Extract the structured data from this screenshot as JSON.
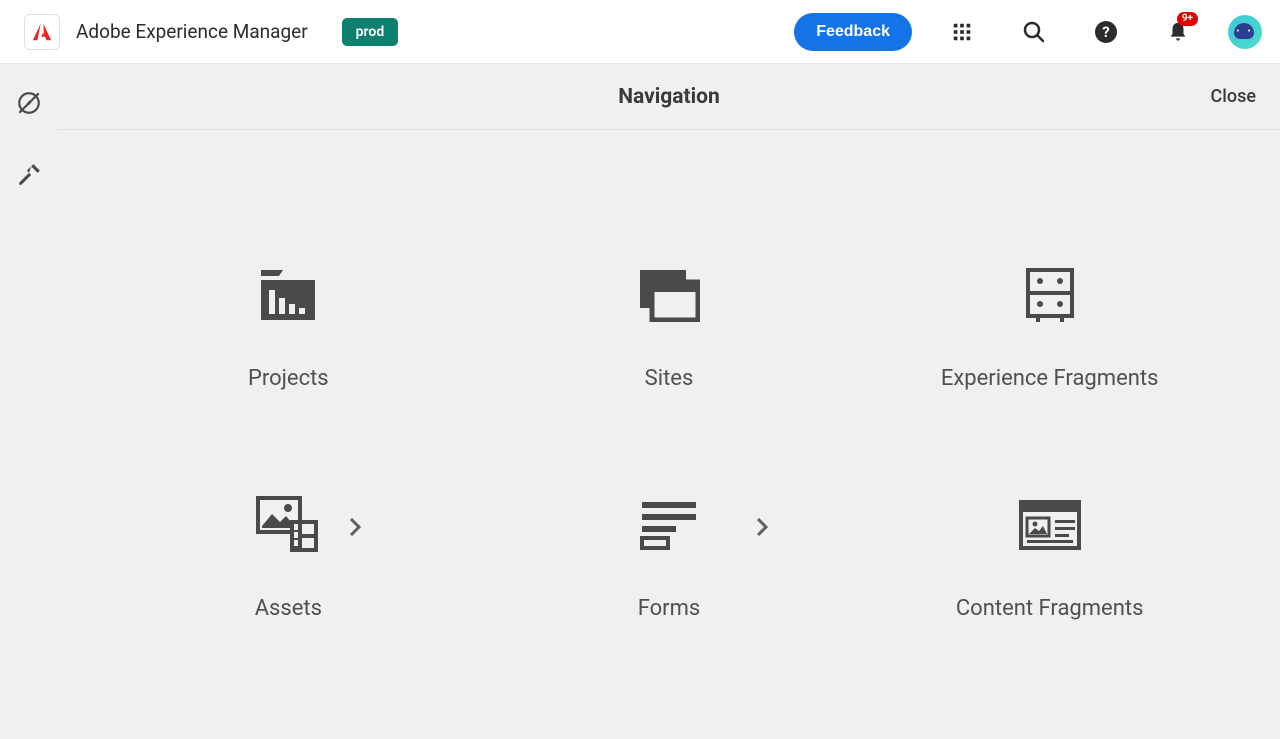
{
  "header": {
    "app_title": "Adobe Experience Manager",
    "env_badge": "prod",
    "feedback_label": "Feedback",
    "notification_badge": "9+"
  },
  "nav": {
    "title": "Navigation",
    "close_label": "Close"
  },
  "tiles": [
    {
      "label": "Projects",
      "icon": "projects-icon"
    },
    {
      "label": "Sites",
      "icon": "sites-icon"
    },
    {
      "label": "Experience Fragments",
      "icon": "experience-fragments-icon"
    },
    {
      "label": "Assets",
      "icon": "assets-icon",
      "has_chevron": true
    },
    {
      "label": "Forms",
      "icon": "forms-icon",
      "has_chevron": true
    },
    {
      "label": "Content Fragments",
      "icon": "content-fragments-icon"
    }
  ]
}
